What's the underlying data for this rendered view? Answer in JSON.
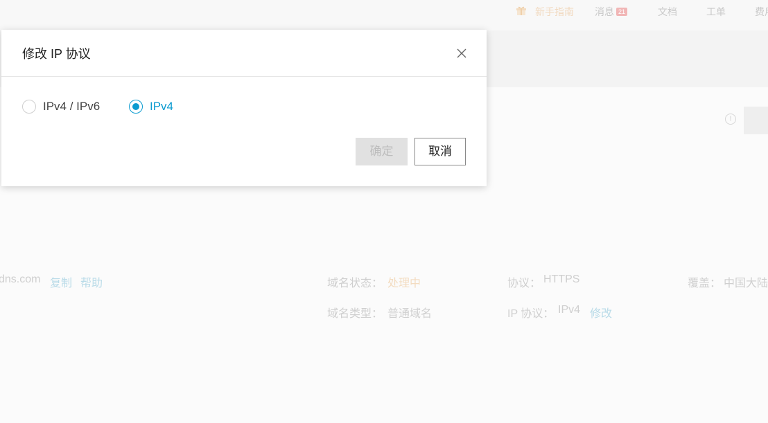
{
  "topbar": {
    "newbie": "新手指南",
    "messages": "消息",
    "messages_badge": "21",
    "docs": "文档",
    "ticket": "工单",
    "fee": "费用"
  },
  "background": {
    "domain_suffix": "dns.com",
    "copy_link": "复制",
    "help_link": "帮助",
    "status_label": "域名状态：",
    "status_value": "处理中",
    "protocol_label": "协议：",
    "protocol_value": "HTTPS",
    "coverage_label": "覆盖：",
    "coverage_value": "中国大陆",
    "type_label": "域名类型：",
    "type_value": "普通域名",
    "ip_protocol_label": "IP 协议：",
    "ip_protocol_value": "IPv4",
    "modify_link": "修改",
    "info_icon": "!"
  },
  "modal": {
    "title": "修改 IP 协议",
    "options": [
      {
        "label": "IPv4 / IPv6",
        "checked": false
      },
      {
        "label": "IPv4",
        "checked": true
      }
    ],
    "confirm_label": "确定",
    "cancel_label": "取消"
  },
  "colors": {
    "accent": "#0b9bd0",
    "disabled_bg": "#e1e1e1"
  }
}
